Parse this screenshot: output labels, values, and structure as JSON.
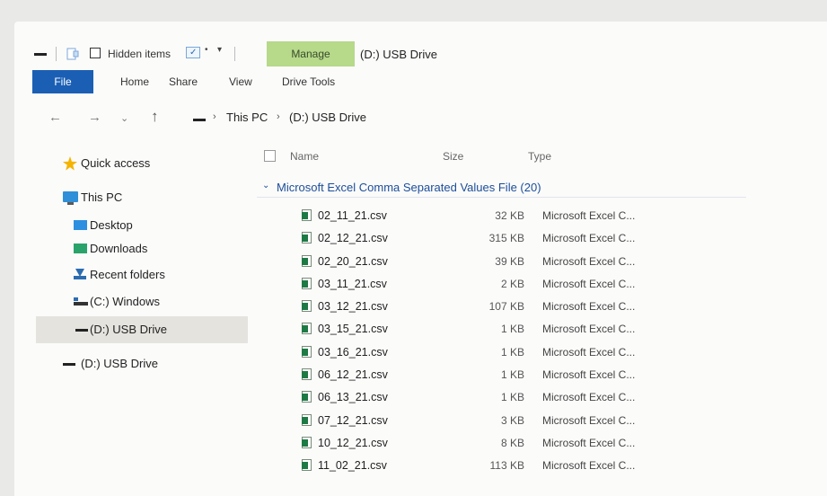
{
  "quick_access_toolbar": {
    "hidden_items_label": "Hidden items"
  },
  "ribbon": {
    "contextual_tab": "Manage",
    "window_title": "(D:) USB Drive",
    "tabs": [
      "File",
      "Home",
      "Share",
      "View",
      "Drive Tools"
    ]
  },
  "address_bar": {
    "breadcrumbs": [
      "This PC",
      "(D:) USB Drive"
    ]
  },
  "nav_pane": {
    "quick_access": "Quick access",
    "this_pc": "This PC",
    "desktop": "Desktop",
    "downloads": "Downloads",
    "recent_folders": "Recent folders",
    "c_drive": "(C:) Windows",
    "d_drive_selected": "(D:) USB Drive",
    "d_drive": "(D:) USB Drive"
  },
  "file_list": {
    "columns": {
      "name": "Name",
      "size": "Size",
      "type": "Type"
    },
    "group_label": "Microsoft Excel Comma Separated Values File (20)",
    "files": [
      {
        "name": "02_11_21.csv",
        "size": "32 KB",
        "type": "Microsoft Excel C..."
      },
      {
        "name": "02_12_21.csv",
        "size": "315 KB",
        "type": "Microsoft Excel C..."
      },
      {
        "name": "02_20_21.csv",
        "size": "39 KB",
        "type": "Microsoft Excel C..."
      },
      {
        "name": "03_11_21.csv",
        "size": "2 KB",
        "type": "Microsoft Excel C..."
      },
      {
        "name": "03_12_21.csv",
        "size": "107 KB",
        "type": "Microsoft Excel C..."
      },
      {
        "name": "03_15_21.csv",
        "size": "1 KB",
        "type": "Microsoft Excel C..."
      },
      {
        "name": "03_16_21.csv",
        "size": "1 KB",
        "type": "Microsoft Excel C..."
      },
      {
        "name": "06_12_21.csv",
        "size": "1 KB",
        "type": "Microsoft Excel C..."
      },
      {
        "name": "06_13_21.csv",
        "size": "1 KB",
        "type": "Microsoft Excel C..."
      },
      {
        "name": "07_12_21.csv",
        "size": "3 KB",
        "type": "Microsoft Excel C..."
      },
      {
        "name": "10_12_21.csv",
        "size": "8 KB",
        "type": "Microsoft Excel C..."
      },
      {
        "name": "11_02_21.csv",
        "size": "113 KB",
        "type": "Microsoft Excel C..."
      }
    ]
  },
  "colors": {
    "file_tab": "#1b5fb4",
    "manage_tab": "#b6d98a",
    "group_label": "#1c4e9a",
    "selected_nav": "#e5e3de"
  }
}
